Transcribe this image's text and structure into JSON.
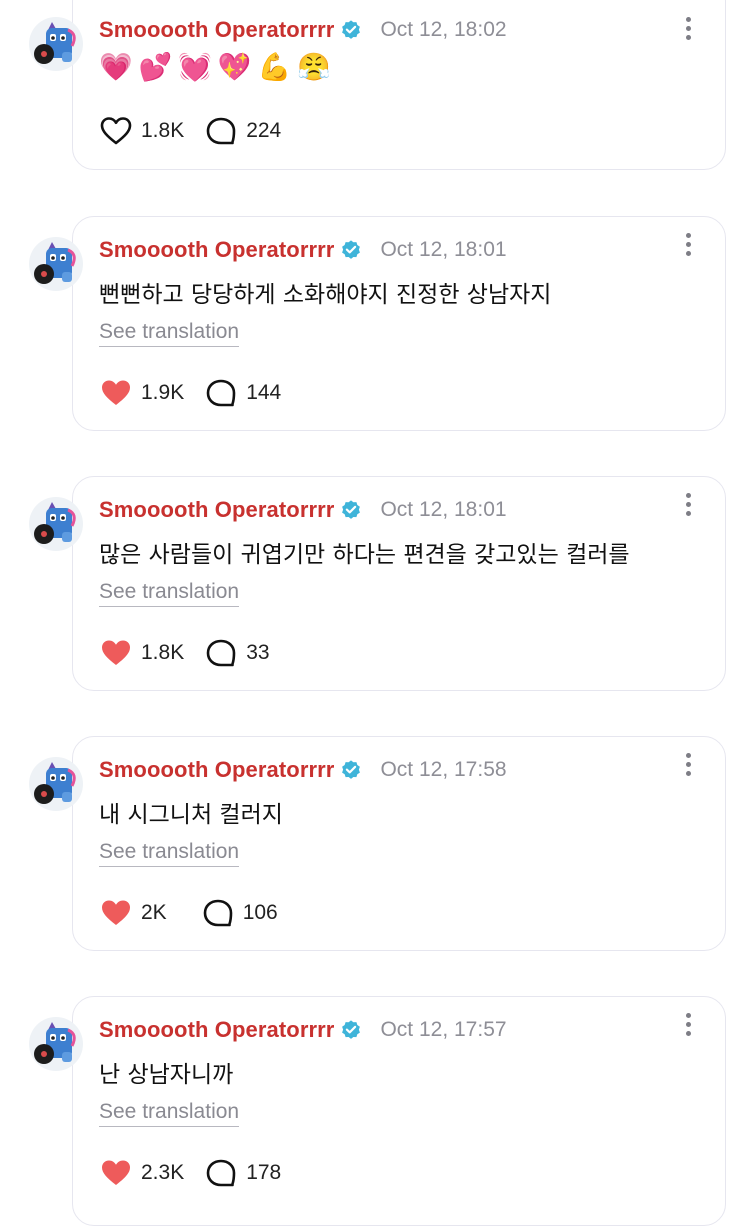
{
  "colors": {
    "name": "#c8312f",
    "heart_filled": "#ee5b5b",
    "verified": "#3fb4d9",
    "muted": "#8a8a92"
  },
  "icons": {
    "like": "heart-icon",
    "comment": "comment-bubble-icon",
    "verified": "verified-badge-icon",
    "more": "more-vertical-icon"
  },
  "posts": [
    {
      "author": "Smooooth Operatorrrr",
      "time": "Oct 12, 18:02",
      "emojis": [
        "💗",
        "💕",
        "💓",
        "💖",
        "💪",
        "😤"
      ],
      "liked": false,
      "likes": "1.8K",
      "comments": "224"
    },
    {
      "author": "Smooooth Operatorrrr",
      "time": "Oct 12, 18:01",
      "text": "뻔뻔하고 당당하게 소화해야지 진정한 상남자지",
      "translate": "See translation",
      "liked": true,
      "likes": "1.9K",
      "comments": "144"
    },
    {
      "author": "Smooooth Operatorrrr",
      "time": "Oct 12, 18:01",
      "text": "많은 사람들이 귀엽기만 하다는 편견을 갖고있는 컬러를",
      "translate": "See translation",
      "liked": true,
      "likes": "1.8K",
      "comments": "33"
    },
    {
      "author": "Smooooth Operatorrrr",
      "time": "Oct 12, 17:58",
      "text": "내 시그니처 컬러지",
      "translate": "See translation",
      "liked": true,
      "likes": "2K",
      "comments": "106"
    },
    {
      "author": "Smooooth Operatorrrr",
      "time": "Oct 12, 17:57",
      "text": "난 상남자니까",
      "translate": "See translation",
      "liked": true,
      "likes": "2.3K",
      "comments": "178"
    }
  ]
}
